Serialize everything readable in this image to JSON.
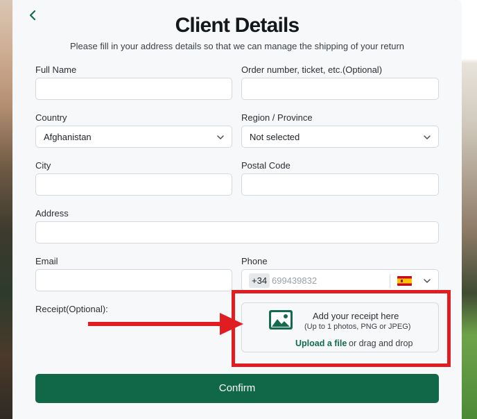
{
  "form": {
    "title": "Client Details",
    "subtitle": "Please fill in your address details so that we can manage the shipping of your return",
    "back_icon": "chevron-left-icon",
    "fields": {
      "full_name": {
        "label": "Full Name",
        "value": ""
      },
      "order_number": {
        "label": "Order number, ticket, etc.(Optional)",
        "value": ""
      },
      "country": {
        "label": "Country",
        "value": "Afghanistan"
      },
      "region": {
        "label": "Region / Province",
        "value": "Not selected"
      },
      "city": {
        "label": "City",
        "value": ""
      },
      "postal_code": {
        "label": "Postal Code",
        "value": ""
      },
      "address": {
        "label": "Address",
        "value": ""
      },
      "email": {
        "label": "Email",
        "value": ""
      },
      "phone": {
        "label": "Phone",
        "dial_code": "+34",
        "placeholder": "699439832",
        "country_flag": "spain-flag-icon"
      },
      "receipt": {
        "label": "Receipt(Optional):"
      }
    },
    "upload": {
      "icon": "image-icon",
      "title": "Add your receipt here",
      "hint": "(Up to 1 photos, PNG or JPEG)",
      "link": "Upload a file",
      "drag_text": "or drag and drop"
    },
    "confirm_label": "Confirm"
  },
  "colors": {
    "accent": "#116849",
    "annotation_red": "#e11d22",
    "panel_bg": "#f7f8f9"
  }
}
